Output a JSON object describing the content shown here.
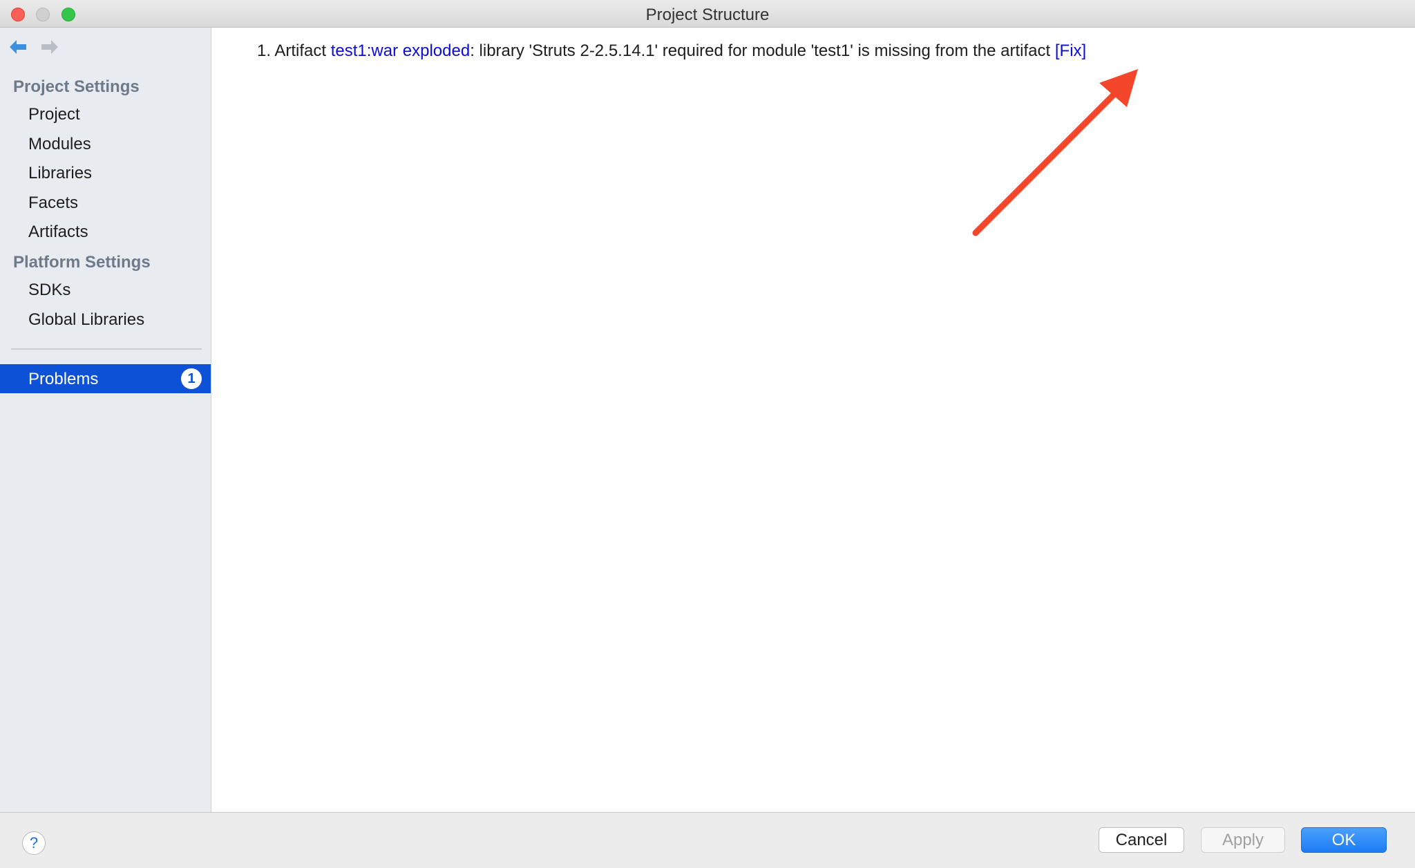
{
  "window": {
    "title": "Project Structure"
  },
  "sidebar": {
    "project_settings_header": "Project Settings",
    "project_items": [
      {
        "label": "Project"
      },
      {
        "label": "Modules"
      },
      {
        "label": "Libraries"
      },
      {
        "label": "Facets"
      },
      {
        "label": "Artifacts"
      }
    ],
    "platform_settings_header": "Platform Settings",
    "platform_items": [
      {
        "label": "SDKs"
      },
      {
        "label": "Global Libraries"
      }
    ],
    "problems": {
      "label": "Problems",
      "count": "1"
    }
  },
  "main": {
    "problems": [
      {
        "number": "1.",
        "prefix": "Artifact",
        "artifact_link": "test1:war exploded",
        "message": ": library 'Struts 2-2.5.14.1' required for module 'test1' is missing from the artifact",
        "fix_link": "[Fix]"
      }
    ],
    "annotation_color": "#f4462a"
  },
  "footer": {
    "help_label": "?",
    "cancel_label": "Cancel",
    "apply_label": "Apply",
    "ok_label": "OK"
  },
  "colors": {
    "selection": "#0d52d6",
    "link": "#0b0bdc",
    "sidebar_bg": "#e8ecf1",
    "section_header": "#6d7a89"
  }
}
